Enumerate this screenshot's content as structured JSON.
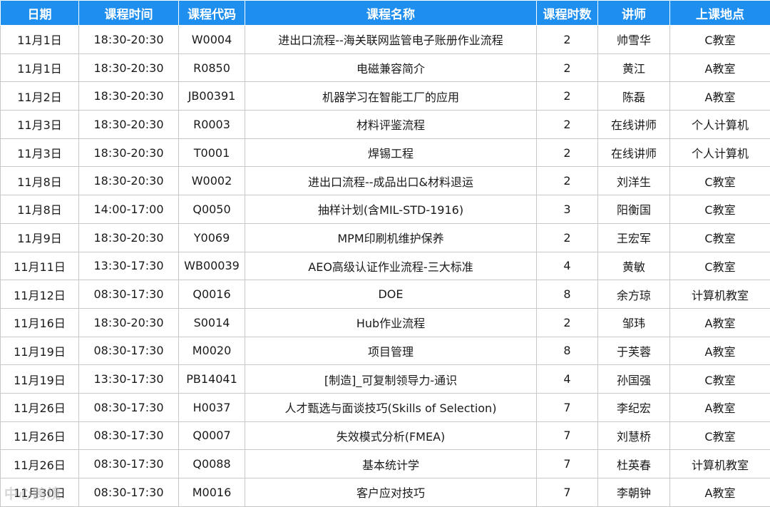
{
  "table": {
    "headers": [
      "日期",
      "课程时间",
      "课程代码",
      "课程名称",
      "课程时数",
      "讲师",
      "上课地点"
    ],
    "rows": [
      [
        "11月1日",
        "18:30-20:30",
        "W0004",
        "进出口流程--海关联网监管电子账册作业流程",
        "2",
        "帅雪华",
        "C教室"
      ],
      [
        "11月1日",
        "18:30-20:30",
        "R0850",
        "电磁兼容简介",
        "2",
        "黄江",
        "A教室"
      ],
      [
        "11月2日",
        "18:30-20:30",
        "JB00391",
        "机器学习在智能工厂的应用",
        "2",
        "陈磊",
        "A教室"
      ],
      [
        "11月3日",
        "18:30-20:30",
        "R0003",
        "材料评鉴流程",
        "2",
        "在线讲师",
        "个人计算机"
      ],
      [
        "11月3日",
        "18:30-20:30",
        "T0001",
        "焊锡工程",
        "2",
        "在线讲师",
        "个人计算机"
      ],
      [
        "11月8日",
        "18:30-20:30",
        "W0002",
        "进出口流程--成品出口&材料退运",
        "2",
        "刘洋生",
        "C教室"
      ],
      [
        "11月8日",
        "14:00-17:00",
        "Q0050",
        "抽样计划(含MIL-STD-1916)",
        "3",
        "阳衡国",
        "C教室"
      ],
      [
        "11月9日",
        "18:30-20:30",
        "Y0069",
        "MPM印刷机维护保养",
        "2",
        "王宏军",
        "C教室"
      ],
      [
        "11月11日",
        "13:30-17:30",
        "WB00039",
        "AEO高级认证作业流程-三大标准",
        "4",
        "黄敏",
        "C教室"
      ],
      [
        "11月12日",
        "08:30-17:30",
        "Q0016",
        "DOE",
        "8",
        "余方琼",
        "计算机教室"
      ],
      [
        "11月16日",
        "18:30-20:30",
        "S0014",
        "Hub作业流程",
        "2",
        "邹玮",
        "A教室"
      ],
      [
        "11月19日",
        "08:30-17:30",
        "M0020",
        "项目管理",
        "8",
        "于芙蓉",
        "A教室"
      ],
      [
        "11月19日",
        "13:30-17:30",
        "PB14041",
        "[制造]_可复制领导力-通识",
        "4",
        "孙国强",
        "C教室"
      ],
      [
        "11月26日",
        "08:30-17:30",
        "H0037",
        "人才甄选与面谈技巧(Skills of Selection)",
        "7",
        "李纪宏",
        "A教室"
      ],
      [
        "11月26日",
        "08:30-17:30",
        "Q0007",
        "失效模式分析(FMEA)",
        "7",
        "刘慧桥",
        "C教室"
      ],
      [
        "11月26日",
        "08:30-17:30",
        "Q0088",
        "基本统计学",
        "7",
        "杜英春",
        "计算机教室"
      ],
      [
        "11月30日",
        "08:30-17:30",
        "M0016",
        "客户应对技巧",
        "7",
        "李朝钟",
        "A教室"
      ]
    ]
  },
  "watermark": {
    "text": "中心跨境"
  },
  "colors": {
    "header_bg": "#1f8fef",
    "header_text": "#ffffff",
    "grid": "#c8c8c8"
  }
}
